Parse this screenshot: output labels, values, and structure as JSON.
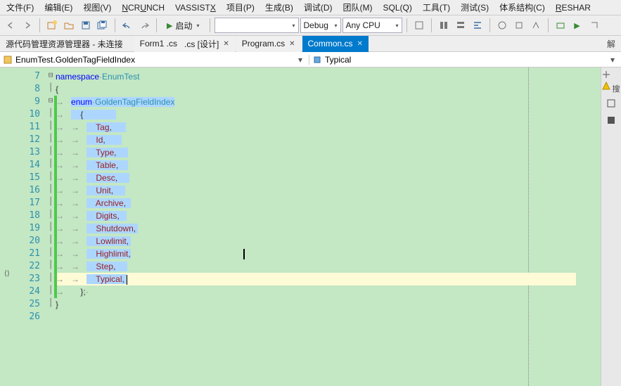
{
  "menu": {
    "file": "文件(F)",
    "edit": "编辑(E)",
    "view": "视图(V)",
    "ncrunch": "NCRUNCH",
    "vassist": "VASSISTX",
    "project": "项目(P)",
    "build": "生成(B)",
    "debug": "调试(D)",
    "team": "团队(M)",
    "sql": "SQL(Q)",
    "tools": "工具(T)",
    "test": "测试(S)",
    "arch": "体系结构(C)",
    "resharper": "RESHAR"
  },
  "toolbar": {
    "start": "启动",
    "config": "Debug",
    "platform": "Any CPU"
  },
  "panel_title": "源代码管理资源管理器 - 未连接",
  "tabs": {
    "t1": "Form1 .cs",
    "t1b": ".cs [设计]",
    "t2": "Program.cs",
    "t3": "Common.cs"
  },
  "nav": {
    "left": "EnumTest.GoldenTagFieldIndex",
    "right": "Typical"
  },
  "side_label": "搜",
  "lines": {
    "start": 7,
    "end": 26,
    "l7": "namespace·EnumTest",
    "l8": "{",
    "l9a": "enum·",
    "l9b": "GoldenTagFieldIndex",
    "l10": "{",
    "members": [
      "Tag",
      "Id",
      "Type",
      "Table",
      "Desc",
      "Unit",
      "Archive",
      "Digits",
      "Shutdown",
      "Lowlimit",
      "Highlimit",
      "Step",
      "Typical"
    ],
    "l24": "};·",
    "l25": "}"
  }
}
